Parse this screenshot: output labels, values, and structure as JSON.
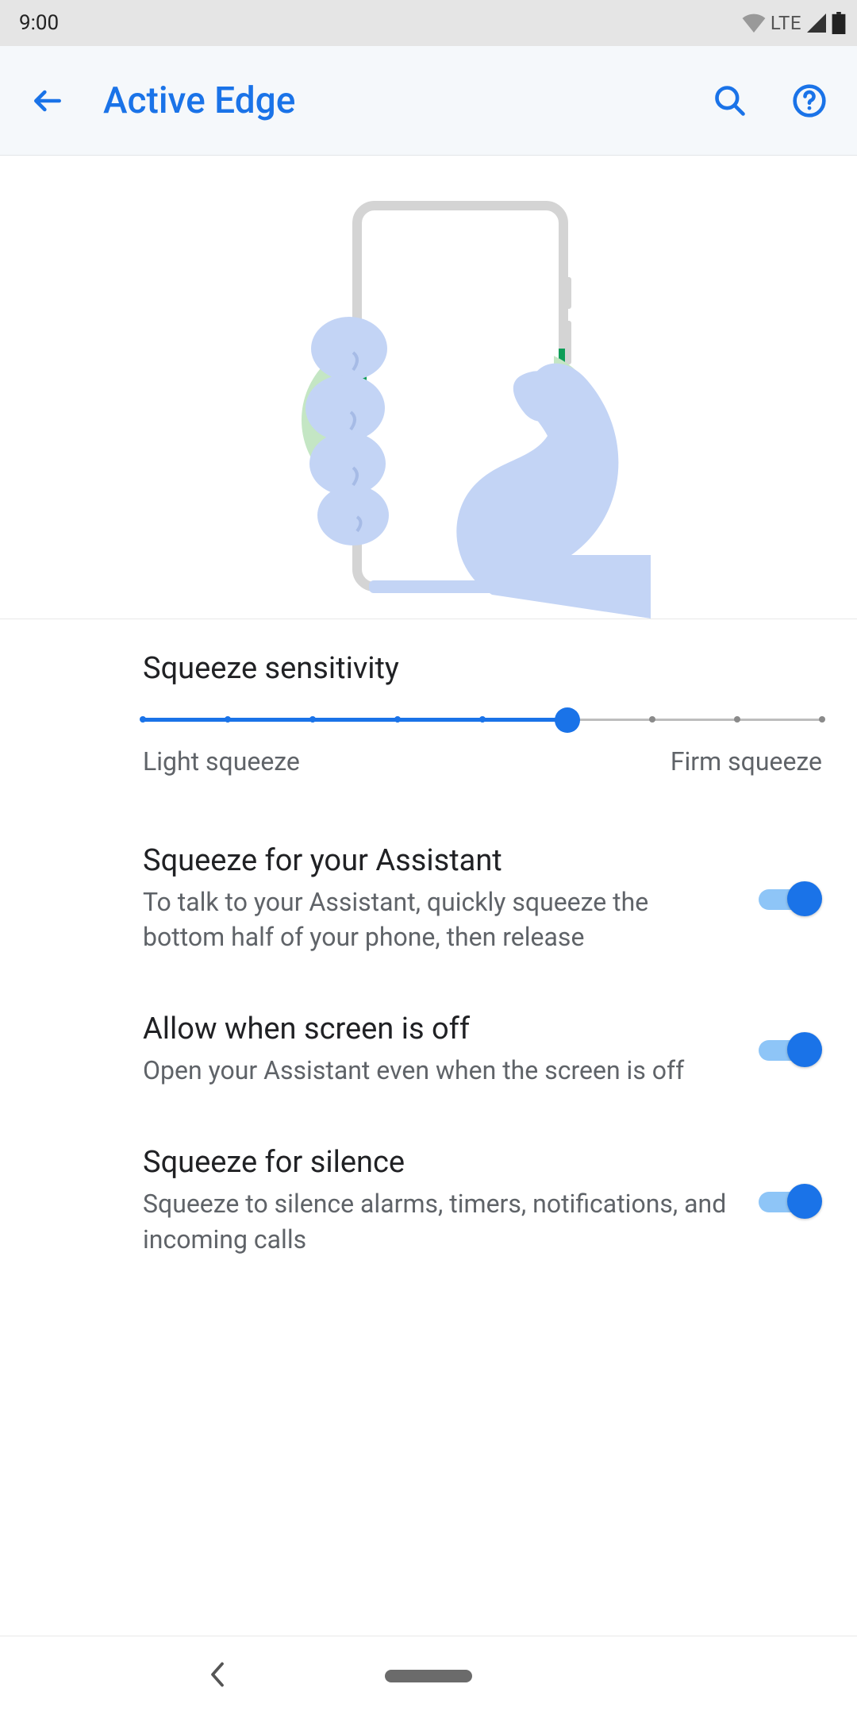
{
  "status": {
    "time": "9:00",
    "lte": "LTE"
  },
  "header": {
    "title": "Active Edge"
  },
  "sensitivity": {
    "label": "Squeeze sensitivity",
    "min_label": "Light squeeze",
    "max_label": "Firm squeeze",
    "ticks": 9,
    "value_index": 5
  },
  "prefs": [
    {
      "title": "Squeeze for your Assistant",
      "sub": "To talk to your Assistant, quickly squeeze the bottom half of your phone, then release",
      "on": true
    },
    {
      "title": "Allow when screen is off",
      "sub": "Open your Assistant even when the screen is off",
      "on": true
    },
    {
      "title": "Squeeze for silence",
      "sub": "Squeeze to silence alarms, timers, notifications, and incoming calls",
      "on": true
    }
  ]
}
